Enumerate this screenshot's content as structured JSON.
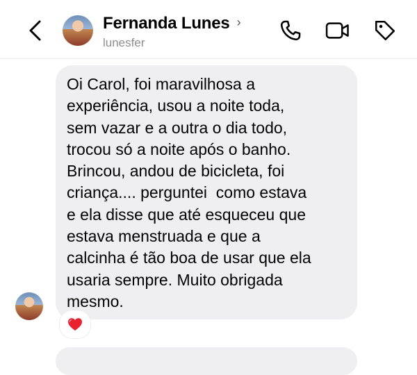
{
  "header": {
    "name": "Fernanda Lunes",
    "username": "lunesfer",
    "chevron": "›",
    "icons": [
      "back-arrow-icon",
      "avatar",
      "phone-icon",
      "video-camera-icon",
      "tag-icon"
    ]
  },
  "message": {
    "text": "Oi Carol, foi maravilhosa a\nexperiência, usou a noite toda,\nsem vazar e a outra o dia todo,\ntrocou só a noite após o banho.\nBrincou, andou de bicicleta, foi\ncriança.... perguntei  como estava\ne ela disse que até esqueceu que\nestava menstruada e que a\ncalcinha é tão boa de usar que ela\nusaria sempre. Muito obrigada\nmesmo.",
    "reaction": "❤️"
  },
  "colors": {
    "bubble": "#efeff1",
    "username": "#8e8e8e",
    "divider": "#ececec"
  }
}
